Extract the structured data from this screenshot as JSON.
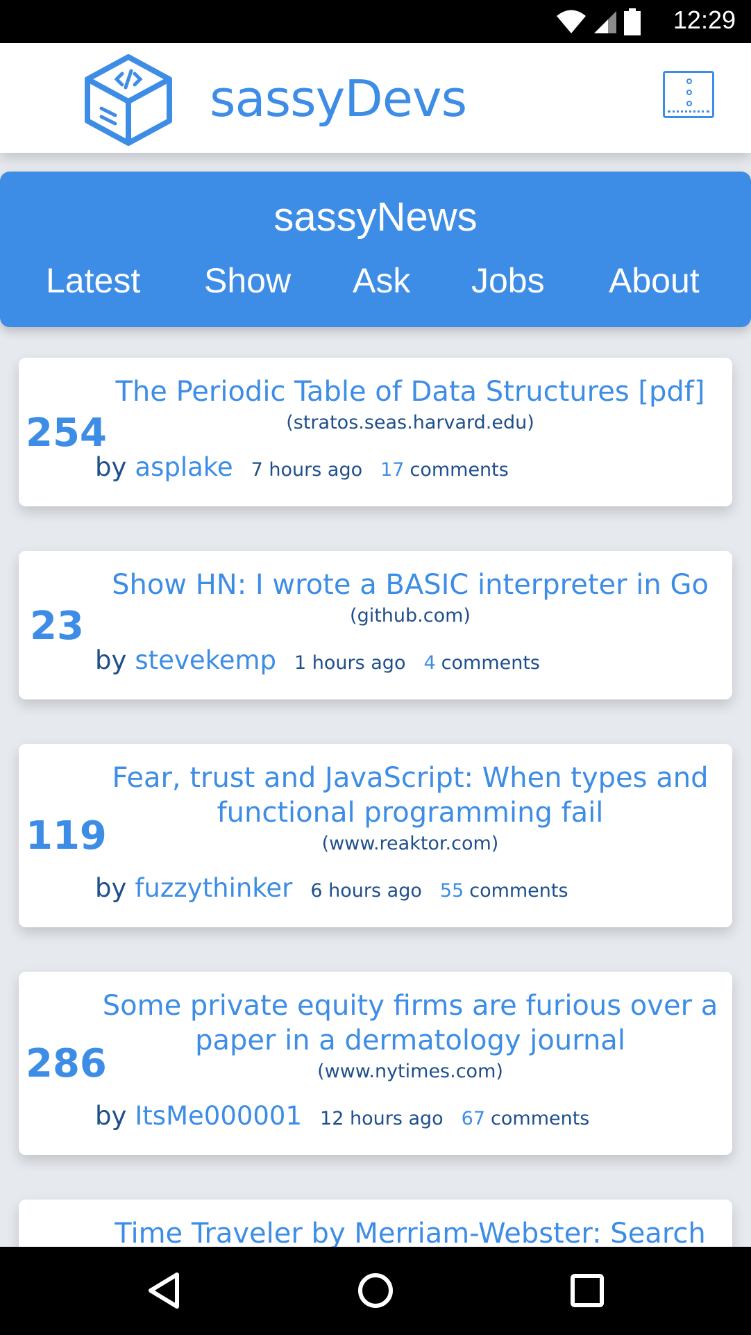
{
  "status": {
    "time": "12:29",
    "icons": [
      "wifi-icon",
      "signal-icon",
      "battery-icon"
    ]
  },
  "app": {
    "brand": "sassyDevs",
    "logo": "code-box-logo",
    "menu_icon": "menu-icon"
  },
  "section": {
    "title": "sassyNews"
  },
  "tabs": [
    {
      "label": "Latest"
    },
    {
      "label": "Show"
    },
    {
      "label": "Ask"
    },
    {
      "label": "Jobs"
    },
    {
      "label": "About"
    }
  ],
  "stories": [
    {
      "score": "254",
      "title": "The Periodic Table of Data Structures [pdf]",
      "domain": "(stratos.seas.harvard.edu)",
      "by": "by",
      "author": "asplake",
      "age": "7 hours ago",
      "comment_count": "17",
      "comment_label": "comments"
    },
    {
      "score": "23",
      "title": "Show HN: I wrote a BASIC interpreter in Go",
      "domain": "(github.com)",
      "by": "by",
      "author": "stevekemp",
      "age": "1 hours ago",
      "comment_count": "4",
      "comment_label": "comments"
    },
    {
      "score": "119",
      "title": "Fear, trust and JavaScript: When types and functional programming fail",
      "domain": "(www.reaktor.com)",
      "by": "by",
      "author": "fuzzythinker",
      "age": "6 hours ago",
      "comment_count": "55",
      "comment_label": "comments"
    },
    {
      "score": "286",
      "title": "Some private equity firms are furious over a paper in a dermatology journal",
      "domain": "(www.nytimes.com)",
      "by": "by",
      "author": "ItsMe000001",
      "age": "12 hours ago",
      "comment_count": "67",
      "comment_label": "comments"
    },
    {
      "title": "Time Traveler by Merriam-Webster: Search"
    }
  ],
  "system_nav": [
    "back-icon",
    "home-icon",
    "recents-icon"
  ],
  "colors": {
    "accent": "#3d8de6",
    "text_dark": "#1f4f8a",
    "background": "#e6e9ee"
  }
}
